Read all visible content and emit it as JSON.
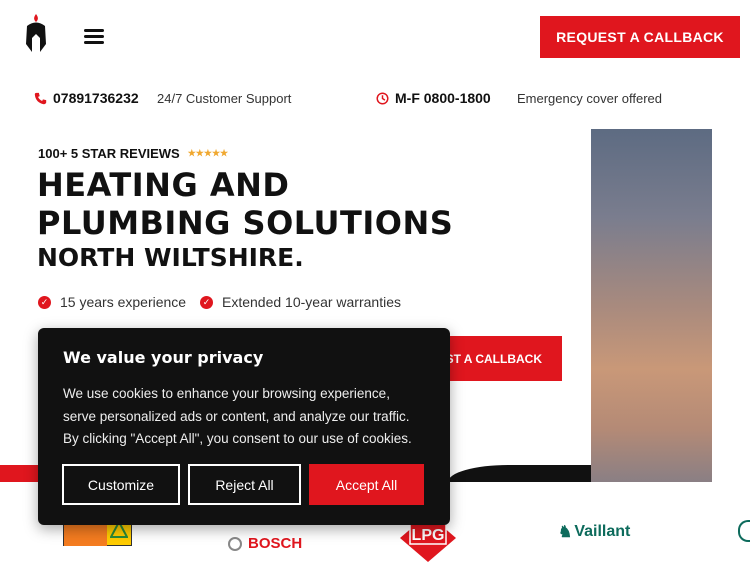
{
  "header": {
    "cta_label": "REQUEST A CALLBACK"
  },
  "infobar": {
    "phone": "07891736232",
    "support": "24/7 Customer Support",
    "hours": "M-F 0800-1800",
    "emergency": "Emergency cover offered"
  },
  "hero": {
    "reviews_label": "100+ 5 STAR REVIEWS",
    "stars": "★★★★★",
    "title_line1": "HEATING AND",
    "title_line2": "PLUMBING SOLUTIONS",
    "subtitle": "NORTH WILTSHIRE.",
    "features": [
      "15 years experience",
      "Extended 10-year warranties"
    ],
    "cta_label": "EST A CALLBACK"
  },
  "brands": {
    "bosch": "BOSCH",
    "lpg": "LPG",
    "vaillant": "Vaillant"
  },
  "cookie": {
    "title": "We value your privacy",
    "text": "We use cookies to enhance your browsing experience, serve personalized ads or content, and analyze our traffic. By clicking \"Accept All\", you consent to our use of cookies.",
    "customize": "Customize",
    "reject": "Reject All",
    "accept": "Accept All"
  },
  "colors": {
    "accent": "#e0161e",
    "dark": "#111111",
    "star": "#f0a830",
    "vaillant": "#0d6b5c"
  }
}
